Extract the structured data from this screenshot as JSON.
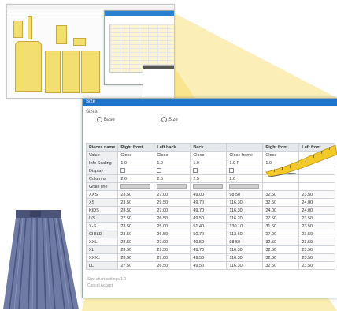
{
  "dialog": {
    "title": "S/ze",
    "section_label": "Sizes",
    "radio_a": "Base",
    "radio_b": "Size"
  },
  "table": {
    "columns": [
      "Pieces name",
      "Right front",
      "Left back",
      "Back",
      "...",
      "Right front",
      "Left front"
    ],
    "prop_rows": [
      {
        "label": "Value",
        "values": [
          "Close",
          "Close",
          "Close",
          "Close frame",
          "Close",
          ""
        ]
      },
      {
        "label": "Info Scaling",
        "values": [
          "1.0",
          "1.0",
          "1.0",
          "1.0 F",
          "1.0",
          ""
        ]
      },
      {
        "label": "Display",
        "values": [
          "",
          "",
          "",
          "",
          "",
          ""
        ]
      },
      {
        "label": "Columns",
        "values": [
          "2.6",
          "2.5",
          "2.5",
          "2.6",
          "",
          ""
        ]
      },
      {
        "label": "Grain line",
        "values": [
          "",
          "",
          "",
          "",
          "",
          ""
        ]
      }
    ],
    "rows": [
      {
        "size": "XXS",
        "values": [
          "23.50",
          "27.00",
          "49.00",
          "98.50",
          "32.50",
          "23.50"
        ]
      },
      {
        "size": "XS",
        "values": [
          "23.50",
          "29.50",
          "49.70",
          "116.30",
          "32.50",
          "24.00"
        ]
      },
      {
        "size": "KIDS",
        "values": [
          "23.50",
          "27.00",
          "49.70",
          "116.30",
          "24.00",
          "24.00"
        ]
      },
      {
        "size": "L/S",
        "values": [
          "27.50",
          "26.50",
          "49.50",
          "116.20",
          "27.50",
          "23.50"
        ]
      },
      {
        "size": "X-S",
        "values": [
          "23.50",
          "25.00",
          "51.40",
          "130.10",
          "31.50",
          "23.50"
        ]
      },
      {
        "size": "CHILD",
        "values": [
          "23.50",
          "26.50",
          "50.70",
          "113.60",
          "27.00",
          "23.50"
        ]
      },
      {
        "size": "XXL",
        "values": [
          "23.50",
          "27.00",
          "49.50",
          "98.50",
          "32.50",
          "23.50"
        ]
      },
      {
        "size": "XL",
        "values": [
          "23.50",
          "29.50",
          "49.70",
          "116.30",
          "32.50",
          "23.50"
        ]
      },
      {
        "size": "XXXL",
        "values": [
          "23.50",
          "27.00",
          "49.50",
          "116.30",
          "32.50",
          "23.50"
        ]
      },
      {
        "size": "LL",
        "values": [
          "27.50",
          "26.50",
          "49.50",
          "116.30",
          "32.50",
          "23.50"
        ]
      }
    ]
  },
  "footer": {
    "line1": "Size chart settings 1.0",
    "line2": "Cancel   Accept"
  },
  "colors": {
    "accent": "#1f74c9",
    "highlight": "#f5dd6a",
    "beam": "#f7e07a"
  },
  "icons": [
    "tape-measure-icon",
    "skirt-image"
  ]
}
